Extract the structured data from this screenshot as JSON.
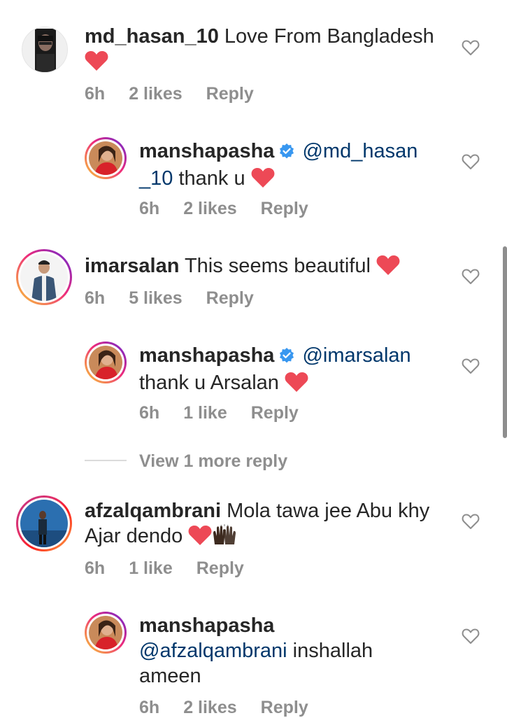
{
  "comments": [
    {
      "username": "md_hasan_10",
      "text": "Love From Bangladesh",
      "time": "6h",
      "likes": "2 likes",
      "reply_label": "Reply",
      "replies": [
        {
          "username": "manshapasha",
          "mention": "@md_hasan",
          "mention_cont": "_10",
          "text": "thank u",
          "time": "6h",
          "likes": "2 likes",
          "reply_label": "Reply"
        }
      ]
    },
    {
      "username": "imarsalan",
      "text": "This seems beautiful",
      "time": "6h",
      "likes": "5 likes",
      "reply_label": "Reply",
      "replies": [
        {
          "username": "manshapasha",
          "mention": "@imarsalan",
          "text": "thank u Arsalan",
          "time": "6h",
          "likes": "1 like",
          "reply_label": "Reply"
        }
      ],
      "view_more": "View 1 more reply"
    },
    {
      "username": "afzalqambrani",
      "text_line1": "Mola tawa jee Abu khy",
      "text_line2": "Ajar dendo",
      "time": "6h",
      "likes": "1 like",
      "reply_label": "Reply",
      "replies": [
        {
          "username": "manshapasha",
          "mention": "@afzalqambrani",
          "text_line1": "inshallah",
          "text_line2": "ameen",
          "time": "6h",
          "likes": "2 likes",
          "reply_label": "Reply"
        }
      ]
    }
  ],
  "colors": {
    "text": "#262626",
    "meta": "#8e8e8e",
    "mention": "#00376b",
    "verified": "#3897f0",
    "heart": "#ed4956"
  },
  "icons": {
    "heart_emoji": "red-heart-emoji",
    "like": "heart-outline-icon",
    "verified": "verified-badge-icon",
    "hands": "raised-hands-emoji"
  }
}
